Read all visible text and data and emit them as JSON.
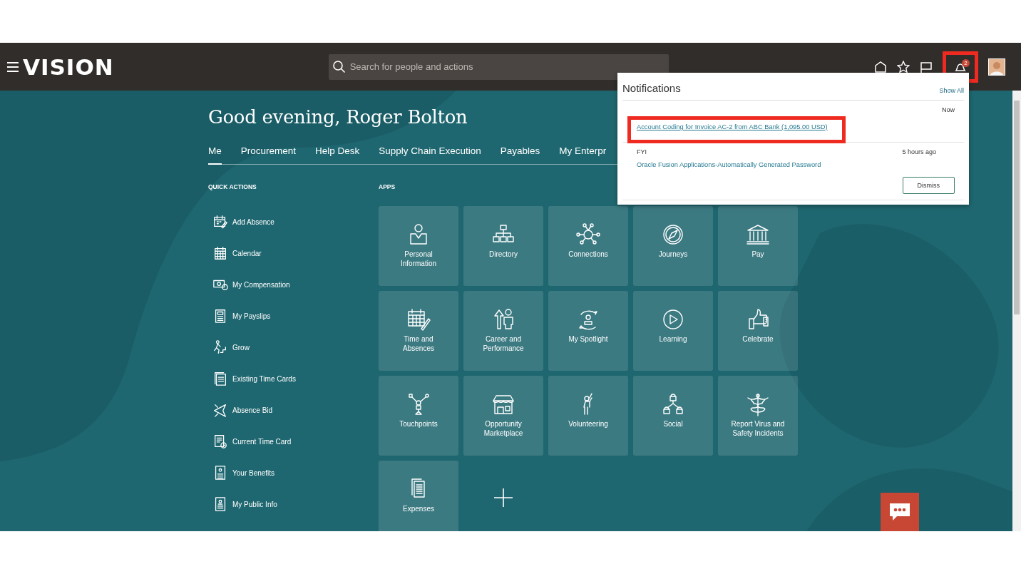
{
  "header": {
    "logo": "VISION",
    "search": {
      "placeholder": "Search for people and actions"
    },
    "notifications": {
      "count": "2",
      "highlighted": true
    }
  },
  "greeting": "Good evening, Roger Bolton",
  "tabs": [
    {
      "label": "Me",
      "selected": true
    },
    {
      "label": "Procurement",
      "selected": false
    },
    {
      "label": "Help Desk",
      "selected": false
    },
    {
      "label": "Supply Chain Execution",
      "selected": false
    },
    {
      "label": "Payables",
      "selected": false
    },
    {
      "label": "My Enterpr",
      "selected": false
    }
  ],
  "quick_actions": {
    "title": "QUICK ACTIONS",
    "items": [
      "Add Absence",
      "Calendar",
      "My Compensation",
      "My Payslips",
      "Grow",
      "Existing Time Cards",
      "Absence Bid",
      "Current Time Card",
      "Your Benefits",
      "My Public Info"
    ]
  },
  "apps": {
    "title": "APPS",
    "items": [
      "Personal\nInformation",
      "Directory",
      "Connections",
      "Journeys",
      "Pay",
      "Time and\nAbsences",
      "Career and\nPerformance",
      "My Spotlight",
      "Learning",
      "Celebrate",
      "Touchpoints",
      "Opportunity\nMarketplace",
      "Volunteering",
      "Social",
      "Report Virus and\nSafety Incidents",
      "Expenses"
    ]
  },
  "notifications_panel": {
    "title": "Notifications",
    "show_all": "Show All",
    "items": [
      {
        "time": "Now",
        "link": "Account Coding for Invoice AC-2 from ABC Bank (1,095.00 USD)",
        "highlighted": true
      },
      {
        "type": "FYI",
        "time": "5 hours ago",
        "link": "Oracle Fusion Applications-Automatically Generated Password",
        "highlighted": false
      }
    ],
    "dismiss": "Dismiss"
  }
}
